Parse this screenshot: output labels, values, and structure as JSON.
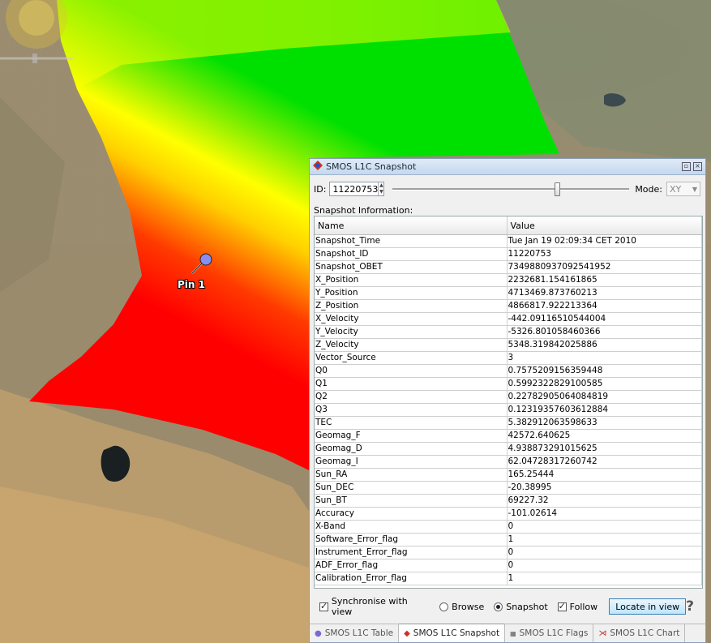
{
  "map": {
    "pin_label": "Pin 1",
    "colors": {
      "land": "#9a8a6c",
      "sand": "#c8a46e",
      "hot": "#ff0000",
      "mid": "#ffff00",
      "cold": "#00e000"
    }
  },
  "panel": {
    "title": "SMOS L1C Snapshot",
    "id_label": "ID:",
    "id_value": "11220753",
    "mode_label": "Mode:",
    "mode_value": "XY",
    "snapshot_info_label": "Snapshot Information:",
    "columns": [
      "Name",
      "Value"
    ],
    "rows": [
      [
        "Snapshot_Time",
        "Tue Jan 19 02:09:34 CET 2010"
      ],
      [
        "Snapshot_ID",
        "11220753"
      ],
      [
        "Snapshot_OBET",
        "7349880937092541952"
      ],
      [
        "X_Position",
        "2232681.154161865"
      ],
      [
        "Y_Position",
        "4713469.873760213"
      ],
      [
        "Z_Position",
        "4866817.922213364"
      ],
      [
        "X_Velocity",
        "-442.09116510544004"
      ],
      [
        "Y_Velocity",
        "-5326.801058460366"
      ],
      [
        "Z_Velocity",
        "5348.319842025886"
      ],
      [
        "Vector_Source",
        "3"
      ],
      [
        "Q0",
        "0.7575209156359448"
      ],
      [
        "Q1",
        "0.5992322829100585"
      ],
      [
        "Q2",
        "0.22782905064084819"
      ],
      [
        "Q3",
        "0.12319357603612884"
      ],
      [
        "TEC",
        "5.382912063598633"
      ],
      [
        "Geomag_F",
        "42572.640625"
      ],
      [
        "Geomag_D",
        "4.938873291015625"
      ],
      [
        "Geomag_I",
        "62.04728317260742"
      ],
      [
        "Sun_RA",
        "165.25444"
      ],
      [
        "Sun_DEC",
        "-20.38995"
      ],
      [
        "Sun_BT",
        "69227.32"
      ],
      [
        "Accuracy",
        "-101.02614"
      ],
      [
        "X-Band",
        "0"
      ],
      [
        "Software_Error_flag",
        "1"
      ],
      [
        "Instrument_Error_flag",
        "0"
      ],
      [
        "ADF_Error_flag",
        "0"
      ],
      [
        "Calibration_Error_flag",
        "1"
      ]
    ],
    "options": {
      "sync_label": "Synchronise with view",
      "browse_label": "Browse",
      "snapshot_label": "Snapshot",
      "follow_label": "Follow",
      "locate_label": "Locate in view",
      "help_label": "?"
    },
    "tabs": [
      {
        "label": "SMOS L1C Table",
        "icon": "table-icon"
      },
      {
        "label": "SMOS L1C Snapshot",
        "icon": "snapshot-icon"
      },
      {
        "label": "SMOS L1C Flags",
        "icon": "flags-icon"
      },
      {
        "label": "SMOS L1C Chart",
        "icon": "chart-icon"
      }
    ]
  }
}
